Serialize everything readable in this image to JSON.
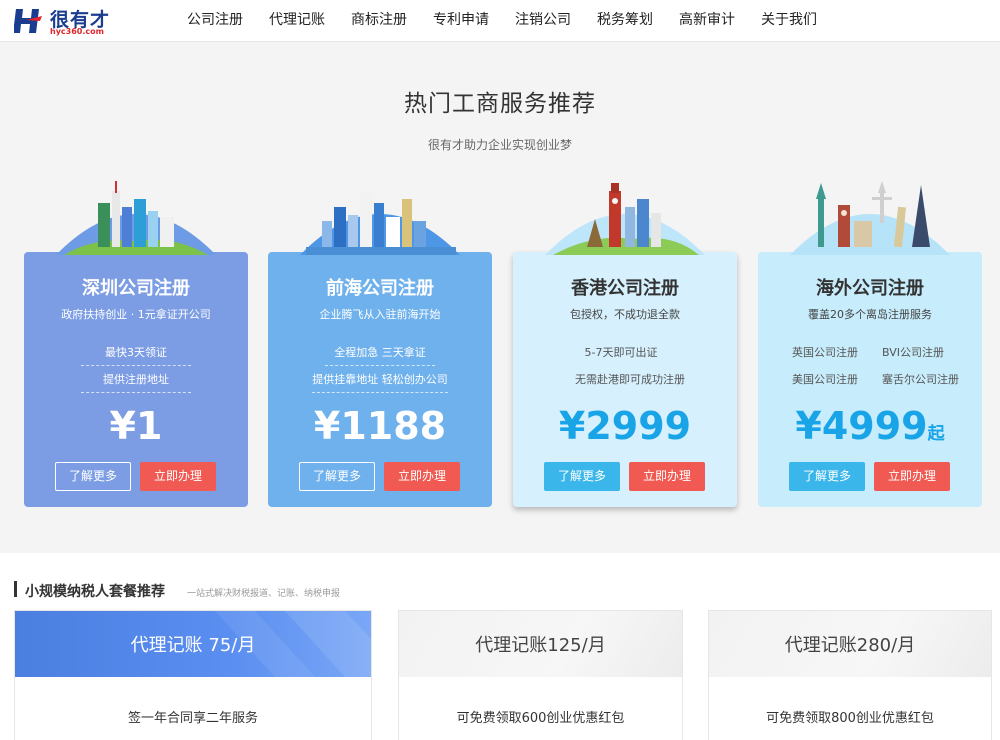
{
  "brand": {
    "name": "很有才",
    "domain": "hyc360.com"
  },
  "nav": [
    "公司注册",
    "代理记账",
    "商标注册",
    "专利申请",
    "注销公司",
    "税务筹划",
    "高新审计",
    "关于我们"
  ],
  "hero": {
    "title": "热门工商服务推荐",
    "subtitle": "很有才助力企业实现创业梦"
  },
  "cards": [
    {
      "title": "深圳公司注册",
      "subtitle": "政府扶持创业 · 1元拿证开公司",
      "features": [
        "最快3天领证",
        "提供注册地址"
      ],
      "price": "¥1",
      "price_suffix": "",
      "more": "了解更多",
      "apply": "立即办理"
    },
    {
      "title": "前海公司注册",
      "subtitle": "企业腾飞从入驻前海开始",
      "features": [
        "全程加急 三天拿证",
        "提供挂靠地址 轻松创办公司"
      ],
      "price": "¥1188",
      "price_suffix": "",
      "more": "了解更多",
      "apply": "立即办理"
    },
    {
      "title": "香港公司注册",
      "subtitle": "包授权，不成功退全款",
      "features": [
        "5-7天即可出证",
        "无需赴港即可成功注册"
      ],
      "price": "¥2999",
      "price_suffix": "",
      "more": "了解更多",
      "apply": "立即办理"
    },
    {
      "title": "海外公司注册",
      "subtitle": "覆盖20多个离岛注册服务",
      "features": [
        "英国公司注册",
        "BVI公司注册",
        "美国公司注册",
        "塞舌尔公司注册"
      ],
      "price": "¥4999",
      "price_suffix": "起",
      "more": "了解更多",
      "apply": "立即办理"
    }
  ],
  "section2": {
    "title": "小规模纳税人套餐推荐",
    "subtitle": "一站式解决财税报道、记账、纳税申报",
    "packages": [
      {
        "title": "代理记账 75/月",
        "desc": "签一年合同享二年服务"
      },
      {
        "title": "代理记账125/月",
        "desc": "可免费领取600创业优惠红包"
      },
      {
        "title": "代理记账280/月",
        "desc": "可免费领取800创业优惠红包"
      }
    ]
  },
  "colors": {
    "brand_blue": "#1a3d8f",
    "brand_red": "#e0262b",
    "card1": "#7c9de4",
    "card2": "#6fb1ec",
    "card3": "#d6f0fd",
    "card4": "#c7ecfb",
    "price_blue": "#1aa4e8",
    "apply_red": "#f05a52"
  }
}
